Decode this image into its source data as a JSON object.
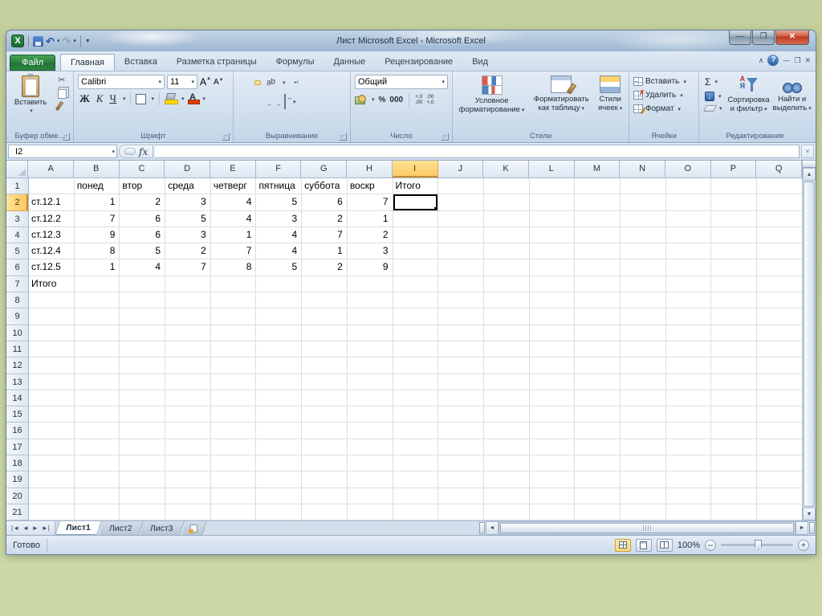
{
  "window": {
    "title": "Лист Microsoft Excel -  Microsoft Excel"
  },
  "ribbon_tabs": {
    "file": "Файл",
    "items": [
      "Главная",
      "Вставка",
      "Разметка страницы",
      "Формулы",
      "Данные",
      "Рецензирование",
      "Вид"
    ],
    "active": "Главная"
  },
  "ribbon": {
    "clipboard": {
      "paste": "Вставить",
      "label": "Буфер обме..."
    },
    "font": {
      "family": "Calibri",
      "size": "11",
      "bold": "Ж",
      "italic": "К",
      "underline": "Ч",
      "label": "Шрифт"
    },
    "alignment": {
      "orientation": "ab",
      "label": "Выравнивание"
    },
    "number": {
      "format": "Общий",
      "percent": "%",
      "thousands": "000",
      "dec_inc": "+,0\n,00",
      "dec_dec": ",00\n+,0",
      "label": "Число"
    },
    "styles": {
      "cond1": "Условное",
      "cond2": "форматирование",
      "table1": "Форматировать",
      "table2": "как таблицу",
      "cell1": "Стили",
      "cell2": "ячеек",
      "label": "Стили"
    },
    "cells": {
      "insert": "Вставить",
      "delete": "Удалить",
      "format": "Формат",
      "label": "Ячейки"
    },
    "editing": {
      "sum": "Σ",
      "sort1": "Сортировка",
      "sort2": "и фильтр",
      "find1": "Найти и",
      "find2": "выделить",
      "label": "Редактирование"
    }
  },
  "formula_bar": {
    "name_box": "I2",
    "fx": "fx",
    "value": ""
  },
  "spreadsheet": {
    "columns": [
      "A",
      "B",
      "C",
      "D",
      "E",
      "F",
      "G",
      "H",
      "I",
      "J",
      "K",
      "L",
      "M",
      "N",
      "O",
      "P",
      "Q"
    ],
    "row_count": 21,
    "selected": {
      "col": "I",
      "row": 2
    },
    "cells": {
      "B1": "понед",
      "C1": "втор",
      "D1": "среда",
      "E1": "четверг",
      "F1": "пятница",
      "G1": "суббота",
      "H1": "воскр",
      "I1": "Итого",
      "A2": "ст.12.1",
      "B2": 1,
      "C2": 2,
      "D2": 3,
      "E2": 4,
      "F2": 5,
      "G2": 6,
      "H2": 7,
      "A3": "ст.12.2",
      "B3": 7,
      "C3": 6,
      "D3": 5,
      "E3": 4,
      "F3": 3,
      "G3": 2,
      "H3": 1,
      "A4": "ст.12.3",
      "B4": 9,
      "C4": 6,
      "D4": 3,
      "E4": 1,
      "F4": 4,
      "G4": 7,
      "H4": 2,
      "A5": "ст.12.4",
      "B5": 8,
      "C5": 5,
      "D5": 2,
      "E5": 7,
      "F5": 4,
      "G5": 1,
      "H5": 3,
      "A6": "ст.12.5",
      "B6": 1,
      "C6": 4,
      "D6": 7,
      "E6": 8,
      "F6": 5,
      "G6": 2,
      "H6": 9,
      "A7": "Итого"
    }
  },
  "sheet_tabs": [
    "Лист1",
    "Лист2",
    "Лист3"
  ],
  "status": {
    "ready": "Готово",
    "zoom": "100%"
  }
}
